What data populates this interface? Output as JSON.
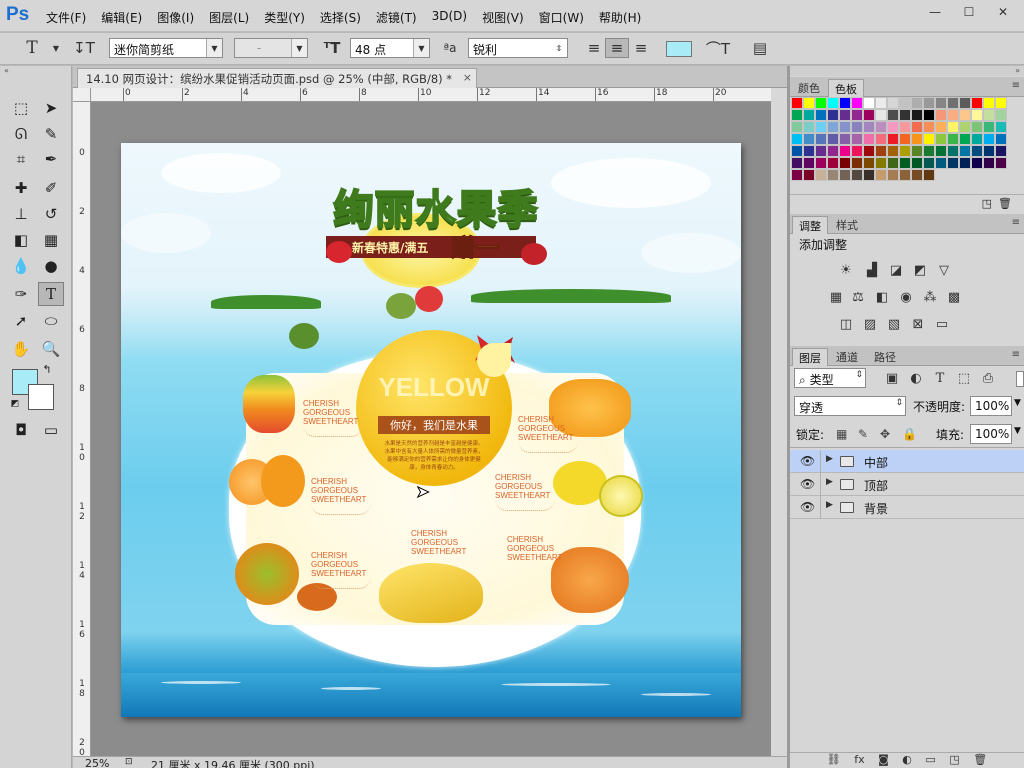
{
  "app": {
    "logo": "Ps"
  },
  "menu": [
    "文件(F)",
    "编辑(E)",
    "图像(I)",
    "图层(L)",
    "类型(Y)",
    "选择(S)",
    "滤镜(T)",
    "3D(D)",
    "视图(V)",
    "窗口(W)",
    "帮助(H)"
  ],
  "window_controls": {
    "minimize": "—",
    "maximize": "☐",
    "close": "✕"
  },
  "options": {
    "tool_glyph": "T",
    "font_family": "迷你简剪纸",
    "font_style": "-",
    "font_size": "48 点",
    "aa_label": "ªa",
    "aa_mode": "锐利",
    "text_color": "#a9ecf7"
  },
  "document": {
    "tab_title": "14.10 网页设计：缤纷水果促销活动页面.psd @ 25% (中部, RGB/8) *",
    "close": "×",
    "ruler_top": [
      "0",
      "2",
      "4",
      "6",
      "8",
      "10",
      "12",
      "14",
      "16",
      "18",
      "20"
    ],
    "ruler_left": [
      "0",
      "2",
      "4",
      "6",
      "8",
      "1\n0",
      "1\n2",
      "1\n4",
      "1\n6",
      "1\n8",
      "2\n0"
    ],
    "zoom": "25%",
    "doc_size": "21 厘米 x 19.46 厘米 (300 ppi)"
  },
  "canvas": {
    "title": "绚丽水果季",
    "subtitle": "新春特惠/满五",
    "gift": "赠一",
    "center_word": "YELLOW",
    "center_tag": "你好，我们是水果",
    "center_desc": "水果是天然的营养剂越是丰富越是健康。水果中含有大量人体所需的微量营养素，能够满足你的营养需求让你的身体更健康，身体青春动力。",
    "label_line1": "CHERISH",
    "label_line2": "GORGEOUS",
    "label_line3": "SWEETHEART"
  },
  "panels": {
    "color_tabs": [
      "颜色",
      "色板"
    ],
    "adjust_tabs": [
      "调整",
      "样式"
    ],
    "adjust_title": "添加调整",
    "layer_tabs": [
      "图层",
      "通道",
      "路径"
    ],
    "filter_kind": "类型",
    "blend_mode": "穿透",
    "opacity_label": "不透明度:",
    "opacity_value": "100%",
    "lock_label": "锁定:",
    "fill_label": "填充:",
    "fill_value": "100%",
    "layers": [
      {
        "name": "中部",
        "selected": true
      },
      {
        "name": "顶部",
        "selected": false
      },
      {
        "name": "背景",
        "selected": false
      }
    ],
    "footer_icons": [
      "link-icon",
      "fx-icon",
      "mask-icon",
      "adjustment-icon",
      "group-icon",
      "new-layer-icon",
      "trash-icon"
    ]
  },
  "swatch_colors": [
    "#ff0000",
    "#ffff00",
    "#00ff00",
    "#00ffff",
    "#0000ff",
    "#ff00ff",
    "#ffffff",
    "#ebebeb",
    "#d6d6d6",
    "#c2c2c2",
    "#adadad",
    "#999999",
    "#858585",
    "#707070",
    "#5c5c5c",
    "#ff0000",
    "#ffff00",
    "#ffff00",
    "#00a651",
    "#00a99d",
    "#0072bc",
    "#2e3192",
    "#662d91",
    "#92278f",
    "#9e005d",
    "#e6e6e6",
    "#4d4d4d",
    "#333333",
    "#1a1a1a",
    "#000000",
    "#f7977a",
    "#f9ad81",
    "#fdc68a",
    "#fff79a",
    "#c4df9b",
    "#a2d39c",
    "#82ca9d",
    "#7bcdc8",
    "#6ecff6",
    "#7ea7d8",
    "#8493ca",
    "#8882be",
    "#a187be",
    "#bc8dbf",
    "#f49ac2",
    "#f6989d",
    "#f26c4f",
    "#f68e55",
    "#fbaf5c",
    "#fff467",
    "#acd372",
    "#7cc576",
    "#3bb878",
    "#1abbb4",
    "#00bff3",
    "#438cca",
    "#5574b9",
    "#605ca8",
    "#855fa8",
    "#a763a8",
    "#f06eaa",
    "#f26d7d",
    "#ed1c24",
    "#f26522",
    "#f7941d",
    "#fff200",
    "#8dc73f",
    "#39b54a",
    "#00a651",
    "#00a99d",
    "#00aeef",
    "#0072bc",
    "#0054a6",
    "#2e3192",
    "#662d91",
    "#92278f",
    "#ec008c",
    "#ed145b",
    "#9e0b0f",
    "#a0410d",
    "#a3620a",
    "#aba000",
    "#598527",
    "#197b30",
    "#007236",
    "#00746b",
    "#0076a3",
    "#004b80",
    "#003471",
    "#1b1464",
    "#440e62",
    "#630460",
    "#9e005d",
    "#9e0039",
    "#790000",
    "#7b2e00",
    "#7d4900",
    "#827b00",
    "#406618",
    "#005e20",
    "#005826",
    "#005952",
    "#005b7f",
    "#003663",
    "#002157",
    "#0d004c",
    "#32004b",
    "#4b0049",
    "#7b0046",
    "#7a0026",
    "#c7b299",
    "#998675",
    "#736357",
    "#534741",
    "#37302a",
    "#c69c6d",
    "#a67c52",
    "#8c6239",
    "#754c24",
    "#603913"
  ]
}
